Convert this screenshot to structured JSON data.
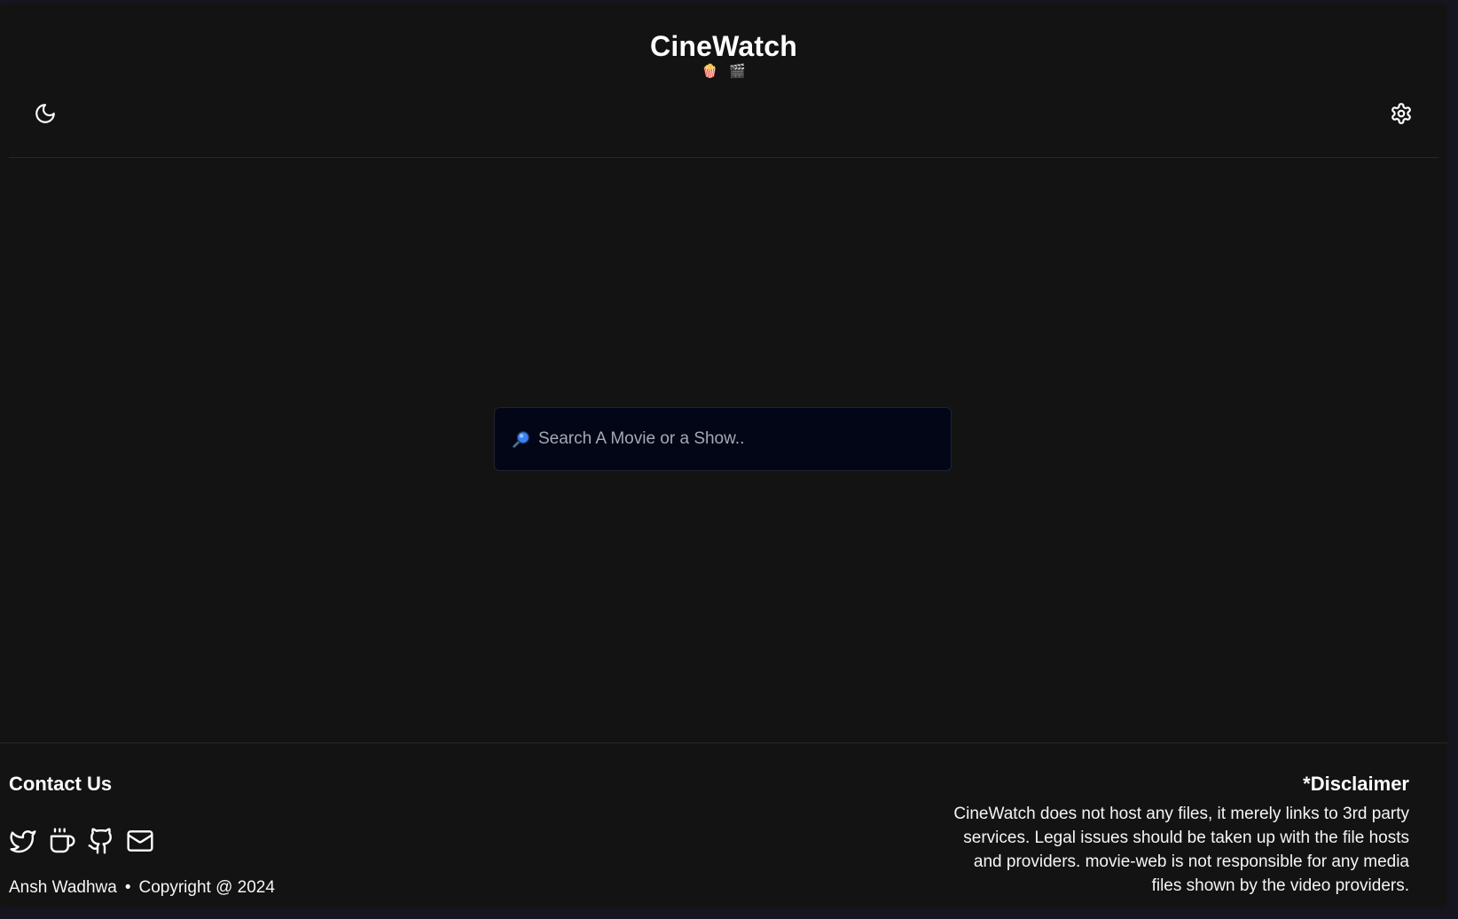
{
  "header": {
    "title": "CineWatch",
    "emojis": [
      "🍿",
      "🎬"
    ],
    "theme_toggle_icon": "moon-icon",
    "settings_icon": "gear-icon"
  },
  "search": {
    "icon": "magnifier-icon",
    "placeholder": "Search A Movie or a Show..",
    "value": ""
  },
  "footer": {
    "contact_title": "Contact Us",
    "social_icons": [
      "twitter-icon",
      "coffee-icon",
      "github-icon",
      "mail-icon"
    ],
    "author": "Ansh Wadhwa",
    "separator": "•",
    "copyright": "Copyright @ 2024",
    "disclaimer_title": "*Disclaimer",
    "disclaimer_text": "CineWatch does not host any files, it merely links to 3rd party services. Legal issues should be taken up with the file hosts and providers. movie-web is not responsible for any media files shown by the video providers."
  },
  "colors": {
    "page_bg": "#131313",
    "search_bg": "#020617",
    "text": "#ffffff",
    "placeholder": "#a4a9b4",
    "search_icon_blue": "#3b82f6"
  }
}
